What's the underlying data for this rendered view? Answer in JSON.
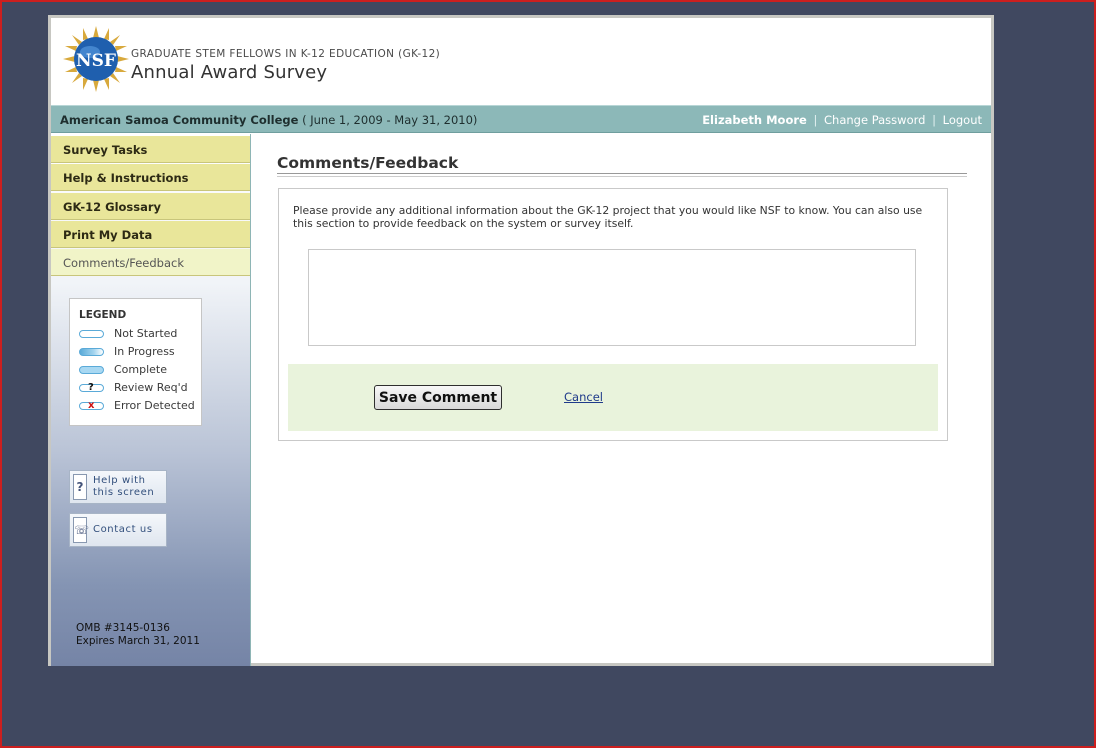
{
  "header": {
    "subtitle": "GRADUATE STEM FELLOWS IN K-12 EDUCATION (GK-12)",
    "title": "Annual Award Survey",
    "logo_text": "NSF"
  },
  "infobar": {
    "organization": "American Samoa Community College",
    "dates": " ( June 1, 2009 - May 31, 2010)",
    "user_name": "Elizabeth Moore",
    "separator": "|",
    "change_password": "Change Password",
    "logout": "Logout"
  },
  "sidebar": {
    "items": [
      {
        "label": "Survey Tasks"
      },
      {
        "label": "Help & Instructions"
      },
      {
        "label": "GK-12 Glossary"
      },
      {
        "label": "Print My Data"
      },
      {
        "label": "Comments/Feedback"
      }
    ],
    "legend": {
      "title": "LEGEND",
      "rows": [
        {
          "label": "Not Started",
          "mark": ""
        },
        {
          "label": "In Progress",
          "mark": ""
        },
        {
          "label": "Complete",
          "mark": ""
        },
        {
          "label": "Review Req'd",
          "mark": "?"
        },
        {
          "label": "Error Detected",
          "mark": "x"
        }
      ]
    },
    "help_button": {
      "line1": "Help with",
      "line2": "this screen",
      "icon_glyph": "?"
    },
    "contact_button": {
      "label": "Contact us",
      "icon_glyph": "☏"
    },
    "omb": {
      "line1": "OMB #3145-0136",
      "line2": "Expires March 31, 2011"
    }
  },
  "main": {
    "title": "Comments/Feedback",
    "instructions": "Please provide any additional information about the GK-12 project that you would like NSF to know. You can also use this section to provide feedback on the system or survey itself.",
    "comment_value": "",
    "save_label": "Save Comment",
    "cancel_label": "Cancel"
  },
  "colors": {
    "background": "#404860",
    "infobar": "#8cb8b8",
    "nav_item": "#e9e69a",
    "action_bar": "#e9f3dc",
    "legend_pill": "#5aaad8"
  }
}
